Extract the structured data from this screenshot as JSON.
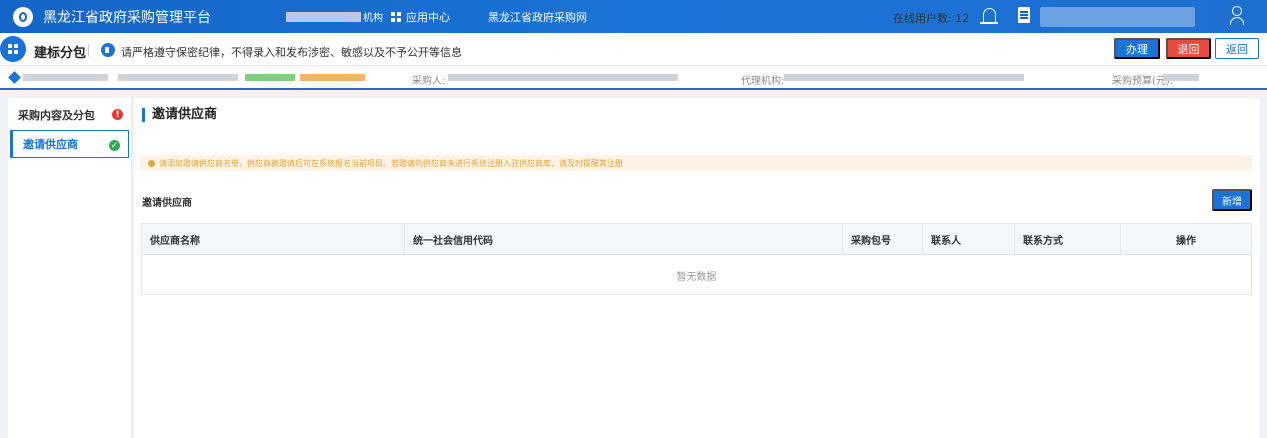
{
  "topbar": {
    "app_title": "黑龙江省政府采购管理平台",
    "masked_suffix": "机构",
    "app_center_label": "应用中心",
    "site_link": "黑龙江省政府采购网",
    "online_users_label": "在线用户数: 12",
    "colors": {
      "bg": "#1a73d6"
    }
  },
  "subheader": {
    "page_name": "建标分包",
    "notice": "请严格遵守保密纪律，不得录入和发布涉密、敏感以及不予公开等信息",
    "buttons": {
      "handle": "办理",
      "return_back": "退回",
      "go_back": "返回"
    }
  },
  "infobar": {
    "purchaser_label": "采购人:",
    "agency_label": "代理机构:",
    "budget_label": "采购预算(元):"
  },
  "leftnav": {
    "items": [
      {
        "label": "采购内容及分包",
        "status": "error",
        "badge": "!"
      },
      {
        "label": "邀请供应商",
        "status": "ok",
        "badge": "✓"
      }
    ]
  },
  "main": {
    "section_title": "邀请供应商",
    "alert": "请添加邀请供应商名单，供应商被邀请后可在系统报名当前项目。若邀请的供应商未进行系统注册入驻供应商库，请及时提醒其注册",
    "sub_title": "邀请供应商",
    "add_button": "新增",
    "table": {
      "columns": [
        "供应商名称",
        "统一社会信用代码",
        "采购包号",
        "联系人",
        "联系方式",
        "操作"
      ],
      "empty_text": "暂无数据"
    }
  }
}
